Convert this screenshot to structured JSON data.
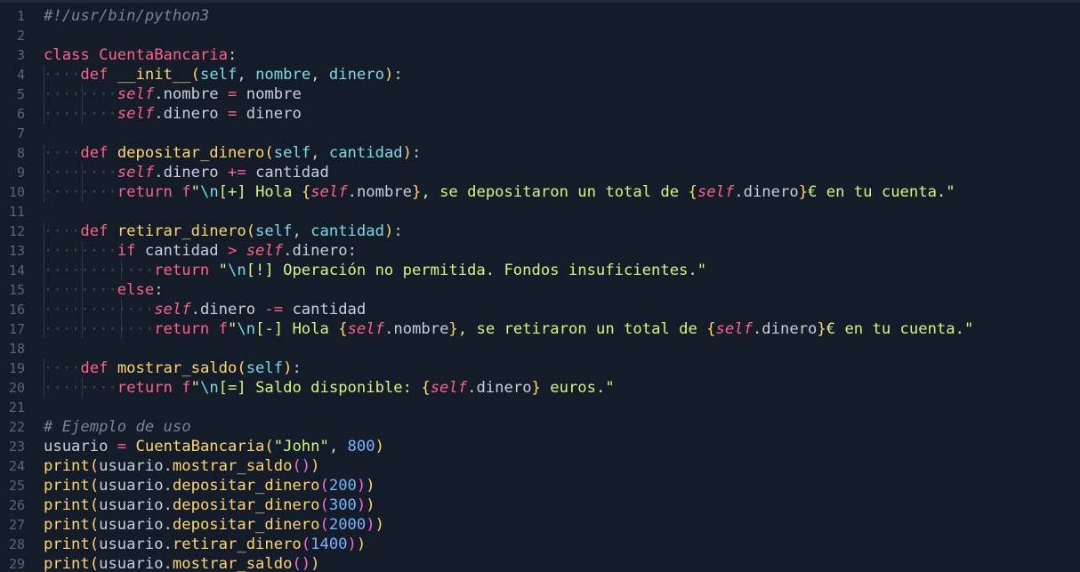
{
  "editor": {
    "language": "python",
    "colors": {
      "background": "#141b29",
      "keyword": "#ff6188",
      "function": "#ffd866",
      "parameter": "#78dce8",
      "string": "#d8f57a",
      "number": "#78b4ff",
      "comment": "#7a8499"
    },
    "lines": [
      {
        "n": "1",
        "indent": 0,
        "tokens": [
          [
            "com",
            "#!/usr/bin/python3"
          ]
        ]
      },
      {
        "n": "2",
        "indent": 0,
        "tokens": []
      },
      {
        "n": "3",
        "indent": 0,
        "tokens": [
          [
            "kw",
            "class"
          ],
          [
            "id",
            " "
          ],
          [
            "cls",
            "CuentaBancaria"
          ],
          [
            "pun",
            ":"
          ]
        ]
      },
      {
        "n": "4",
        "indent": 1,
        "tokens": [
          [
            "def",
            "def"
          ],
          [
            "id",
            " "
          ],
          [
            "fn",
            "__init__"
          ],
          [
            "par1",
            "("
          ],
          [
            "prm",
            "self"
          ],
          [
            "pun",
            ", "
          ],
          [
            "prm",
            "nombre"
          ],
          [
            "pun",
            ", "
          ],
          [
            "prm",
            "dinero"
          ],
          [
            "par1",
            ")"
          ],
          [
            "pun",
            ":"
          ]
        ]
      },
      {
        "n": "5",
        "indent": 2,
        "tokens": [
          [
            "self",
            "self"
          ],
          [
            "pun",
            "."
          ],
          [
            "id",
            "nombre"
          ],
          [
            "id",
            " "
          ],
          [
            "op",
            "="
          ],
          [
            "id",
            " nombre"
          ]
        ]
      },
      {
        "n": "6",
        "indent": 2,
        "tokens": [
          [
            "self",
            "self"
          ],
          [
            "pun",
            "."
          ],
          [
            "id",
            "dinero"
          ],
          [
            "id",
            " "
          ],
          [
            "op",
            "="
          ],
          [
            "id",
            " dinero"
          ]
        ]
      },
      {
        "n": "7",
        "indent": 0,
        "tokens": []
      },
      {
        "n": "8",
        "indent": 1,
        "tokens": [
          [
            "def",
            "def"
          ],
          [
            "id",
            " "
          ],
          [
            "fn",
            "depositar_dinero"
          ],
          [
            "par1",
            "("
          ],
          [
            "prm",
            "self"
          ],
          [
            "pun",
            ", "
          ],
          [
            "prm",
            "cantidad"
          ],
          [
            "par1",
            ")"
          ],
          [
            "pun",
            ":"
          ]
        ]
      },
      {
        "n": "9",
        "indent": 2,
        "tokens": [
          [
            "self",
            "self"
          ],
          [
            "pun",
            "."
          ],
          [
            "id",
            "dinero"
          ],
          [
            "id",
            " "
          ],
          [
            "op",
            "+="
          ],
          [
            "id",
            " cantidad"
          ]
        ]
      },
      {
        "n": "10",
        "indent": 2,
        "tokens": [
          [
            "kw",
            "return"
          ],
          [
            "id",
            " "
          ],
          [
            "op",
            "f"
          ],
          [
            "str",
            "\""
          ],
          [
            "esc",
            "\\n"
          ],
          [
            "str",
            "[+] Hola "
          ],
          [
            "fsp",
            "{"
          ],
          [
            "self",
            "self"
          ],
          [
            "pun",
            "."
          ],
          [
            "id",
            "nombre"
          ],
          [
            "fsp",
            "}"
          ],
          [
            "str",
            ", se depositaron un total de "
          ],
          [
            "fsp",
            "{"
          ],
          [
            "self",
            "self"
          ],
          [
            "pun",
            "."
          ],
          [
            "id",
            "dinero"
          ],
          [
            "fsp",
            "}"
          ],
          [
            "str",
            "€ en tu cuenta.\""
          ]
        ]
      },
      {
        "n": "11",
        "indent": 0,
        "tokens": []
      },
      {
        "n": "12",
        "indent": 1,
        "tokens": [
          [
            "def",
            "def"
          ],
          [
            "id",
            " "
          ],
          [
            "fn",
            "retirar_dinero"
          ],
          [
            "par1",
            "("
          ],
          [
            "prm",
            "self"
          ],
          [
            "pun",
            ", "
          ],
          [
            "prm",
            "cantidad"
          ],
          [
            "par1",
            ")"
          ],
          [
            "pun",
            ":"
          ]
        ]
      },
      {
        "n": "13",
        "indent": 2,
        "tokens": [
          [
            "kw",
            "if"
          ],
          [
            "id",
            " cantidad "
          ],
          [
            "op",
            ">"
          ],
          [
            "id",
            " "
          ],
          [
            "self",
            "self"
          ],
          [
            "pun",
            "."
          ],
          [
            "id",
            "dinero"
          ],
          [
            "pun",
            ":"
          ]
        ]
      },
      {
        "n": "14",
        "indent": 3,
        "tokens": [
          [
            "kw",
            "return"
          ],
          [
            "id",
            " "
          ],
          [
            "str",
            "\""
          ],
          [
            "esc",
            "\\n"
          ],
          [
            "str",
            "[!] Operación no permitida. Fondos insuficientes.\""
          ]
        ]
      },
      {
        "n": "15",
        "indent": 2,
        "tokens": [
          [
            "kw",
            "else"
          ],
          [
            "pun",
            ":"
          ]
        ]
      },
      {
        "n": "16",
        "indent": 3,
        "tokens": [
          [
            "self",
            "self"
          ],
          [
            "pun",
            "."
          ],
          [
            "id",
            "dinero"
          ],
          [
            "id",
            " "
          ],
          [
            "op",
            "-="
          ],
          [
            "id",
            " cantidad"
          ]
        ]
      },
      {
        "n": "17",
        "indent": 3,
        "tokens": [
          [
            "kw",
            "return"
          ],
          [
            "id",
            " "
          ],
          [
            "op",
            "f"
          ],
          [
            "str",
            "\""
          ],
          [
            "esc",
            "\\n"
          ],
          [
            "str",
            "[-] Hola "
          ],
          [
            "fsp",
            "{"
          ],
          [
            "self",
            "self"
          ],
          [
            "pun",
            "."
          ],
          [
            "id",
            "nombre"
          ],
          [
            "fsp",
            "}"
          ],
          [
            "str",
            ", se retiraron un total de "
          ],
          [
            "fsp",
            "{"
          ],
          [
            "self",
            "self"
          ],
          [
            "pun",
            "."
          ],
          [
            "id",
            "dinero"
          ],
          [
            "fsp",
            "}"
          ],
          [
            "str",
            "€ en tu cuenta.\""
          ]
        ]
      },
      {
        "n": "18",
        "indent": 0,
        "tokens": []
      },
      {
        "n": "19",
        "indent": 1,
        "tokens": [
          [
            "def",
            "def"
          ],
          [
            "id",
            " "
          ],
          [
            "fn",
            "mostrar_saldo"
          ],
          [
            "par1",
            "("
          ],
          [
            "prm",
            "self"
          ],
          [
            "par1",
            ")"
          ],
          [
            "pun",
            ":"
          ]
        ]
      },
      {
        "n": "20",
        "indent": 2,
        "tokens": [
          [
            "kw",
            "return"
          ],
          [
            "id",
            " "
          ],
          [
            "op",
            "f"
          ],
          [
            "str",
            "\""
          ],
          [
            "esc",
            "\\n"
          ],
          [
            "str",
            "[=] Saldo disponible: "
          ],
          [
            "fsp",
            "{"
          ],
          [
            "self",
            "self"
          ],
          [
            "pun",
            "."
          ],
          [
            "id",
            "dinero"
          ],
          [
            "fsp",
            "}"
          ],
          [
            "str",
            " euros.\""
          ]
        ]
      },
      {
        "n": "21",
        "indent": 0,
        "tokens": []
      },
      {
        "n": "22",
        "indent": 0,
        "tokens": [
          [
            "com",
            "# Ejemplo de uso"
          ]
        ]
      },
      {
        "n": "23",
        "indent": 0,
        "tokens": [
          [
            "id",
            "usuario "
          ],
          [
            "op",
            "="
          ],
          [
            "id",
            " "
          ],
          [
            "fn",
            "CuentaBancaria"
          ],
          [
            "par1",
            "("
          ],
          [
            "str",
            "\"John\""
          ],
          [
            "pun",
            ", "
          ],
          [
            "num",
            "800"
          ],
          [
            "par1",
            ")"
          ]
        ]
      },
      {
        "n": "24",
        "indent": 0,
        "tokens": [
          [
            "fn",
            "print"
          ],
          [
            "par1",
            "("
          ],
          [
            "id",
            "usuario"
          ],
          [
            "pun",
            "."
          ],
          [
            "fn",
            "mostrar_saldo"
          ],
          [
            "par2",
            "()"
          ],
          [
            "par1",
            ")"
          ]
        ]
      },
      {
        "n": "25",
        "indent": 0,
        "tokens": [
          [
            "fn",
            "print"
          ],
          [
            "par1",
            "("
          ],
          [
            "id",
            "usuario"
          ],
          [
            "pun",
            "."
          ],
          [
            "fn",
            "depositar_dinero"
          ],
          [
            "par2",
            "("
          ],
          [
            "num",
            "200"
          ],
          [
            "par2",
            ")"
          ],
          [
            "par1",
            ")"
          ]
        ]
      },
      {
        "n": "26",
        "indent": 0,
        "tokens": [
          [
            "fn",
            "print"
          ],
          [
            "par1",
            "("
          ],
          [
            "id",
            "usuario"
          ],
          [
            "pun",
            "."
          ],
          [
            "fn",
            "depositar_dinero"
          ],
          [
            "par2",
            "("
          ],
          [
            "num",
            "300"
          ],
          [
            "par2",
            ")"
          ],
          [
            "par1",
            ")"
          ]
        ]
      },
      {
        "n": "27",
        "indent": 0,
        "tokens": [
          [
            "fn",
            "print"
          ],
          [
            "par1",
            "("
          ],
          [
            "id",
            "usuario"
          ],
          [
            "pun",
            "."
          ],
          [
            "fn",
            "depositar_dinero"
          ],
          [
            "par2",
            "("
          ],
          [
            "num",
            "2000"
          ],
          [
            "par2",
            ")"
          ],
          [
            "par1",
            ")"
          ]
        ]
      },
      {
        "n": "28",
        "indent": 0,
        "tokens": [
          [
            "fn",
            "print"
          ],
          [
            "par1",
            "("
          ],
          [
            "id",
            "usuario"
          ],
          [
            "pun",
            "."
          ],
          [
            "fn",
            "retirar_dinero"
          ],
          [
            "par2",
            "("
          ],
          [
            "num",
            "1400"
          ],
          [
            "par2",
            ")"
          ],
          [
            "par1",
            ")"
          ]
        ]
      },
      {
        "n": "29",
        "indent": 0,
        "tokens": [
          [
            "fn",
            "print"
          ],
          [
            "par1",
            "("
          ],
          [
            "id",
            "usuario"
          ],
          [
            "pun",
            "."
          ],
          [
            "fn",
            "mostrar_saldo"
          ],
          [
            "par2",
            "()"
          ],
          [
            "par1",
            ")"
          ]
        ]
      }
    ]
  }
}
